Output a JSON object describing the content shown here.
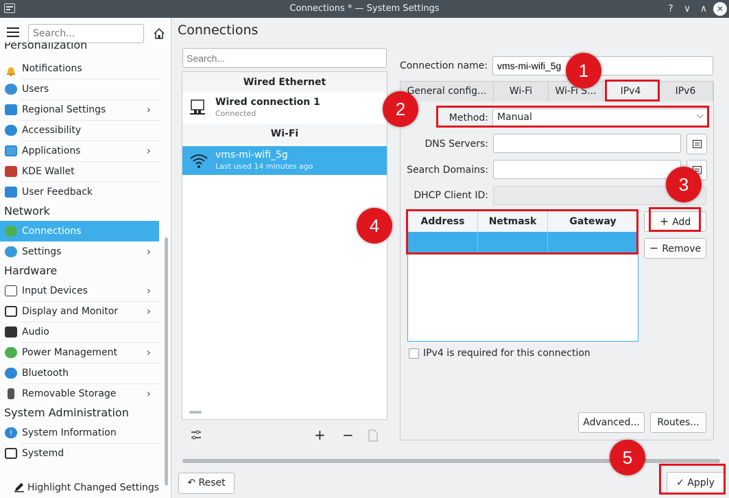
{
  "window": {
    "title": "Connections * — System Settings",
    "help": "?",
    "minimize": "∨",
    "maximize": "∧",
    "close": "✕"
  },
  "sidebar": {
    "search_placeholder": "Search...",
    "sections": {
      "personalization": "Personalization",
      "network": "Network",
      "hardware": "Hardware",
      "sysadmin": "System Administration"
    },
    "items": [
      {
        "label": "Notifications",
        "chevron": false
      },
      {
        "label": "Users",
        "chevron": false
      },
      {
        "label": "Regional Settings",
        "chevron": true
      },
      {
        "label": "Accessibility",
        "chevron": false
      },
      {
        "label": "Applications",
        "chevron": true
      },
      {
        "label": "KDE Wallet",
        "chevron": false
      },
      {
        "label": "User Feedback",
        "chevron": false
      },
      {
        "label": "Connections",
        "chevron": false
      },
      {
        "label": "Settings",
        "chevron": true
      },
      {
        "label": "Input Devices",
        "chevron": true
      },
      {
        "label": "Display and Monitor",
        "chevron": true
      },
      {
        "label": "Audio",
        "chevron": false
      },
      {
        "label": "Power Management",
        "chevron": true
      },
      {
        "label": "Bluetooth",
        "chevron": false
      },
      {
        "label": "Removable Storage",
        "chevron": true
      },
      {
        "label": "System Information",
        "chevron": false
      },
      {
        "label": "Systemd",
        "chevron": false
      }
    ],
    "highlight_label": "Highlight Changed Settings"
  },
  "page": {
    "title": "Connections"
  },
  "connections": {
    "search_placeholder": "Search...",
    "group_wired": "Wired Ethernet",
    "group_wifi": "Wi-Fi",
    "wired": {
      "name": "Wired connection 1",
      "status": "Connected"
    },
    "wifi": {
      "name": "vms-mi-wifi_5g",
      "status": "Last used 14 minutes ago"
    },
    "buttons": {
      "add": "+",
      "remove": "−"
    }
  },
  "editor": {
    "connection_name_label": "Connection name:",
    "connection_name_value": "vms-mi-wifi_5g",
    "tabs": [
      "General config...",
      "Wi-Fi",
      "Wi-Fi S...",
      "IPv4",
      "IPv6"
    ],
    "active_tab": "IPv4",
    "method_label": "Method:",
    "method_value": "Manual",
    "dns_label": "DNS Servers:",
    "dns_value": "",
    "search_domains_label": "Search Domains:",
    "search_domains_value": "",
    "dhcp_label": "DHCP Client ID:",
    "dhcp_value": "",
    "table_headers": [
      "Address",
      "Netmask",
      "Gateway"
    ],
    "add_label": "Add",
    "remove_label": "Remove",
    "ipv4_required_label": "IPv4 is required for this connection",
    "ipv4_required_checked": false,
    "advanced_label": "Advanced...",
    "routes_label": "Routes..."
  },
  "footer": {
    "reset_label": "Reset",
    "apply_label": "Apply"
  },
  "annotations": [
    "1",
    "2",
    "3",
    "4",
    "5"
  ]
}
